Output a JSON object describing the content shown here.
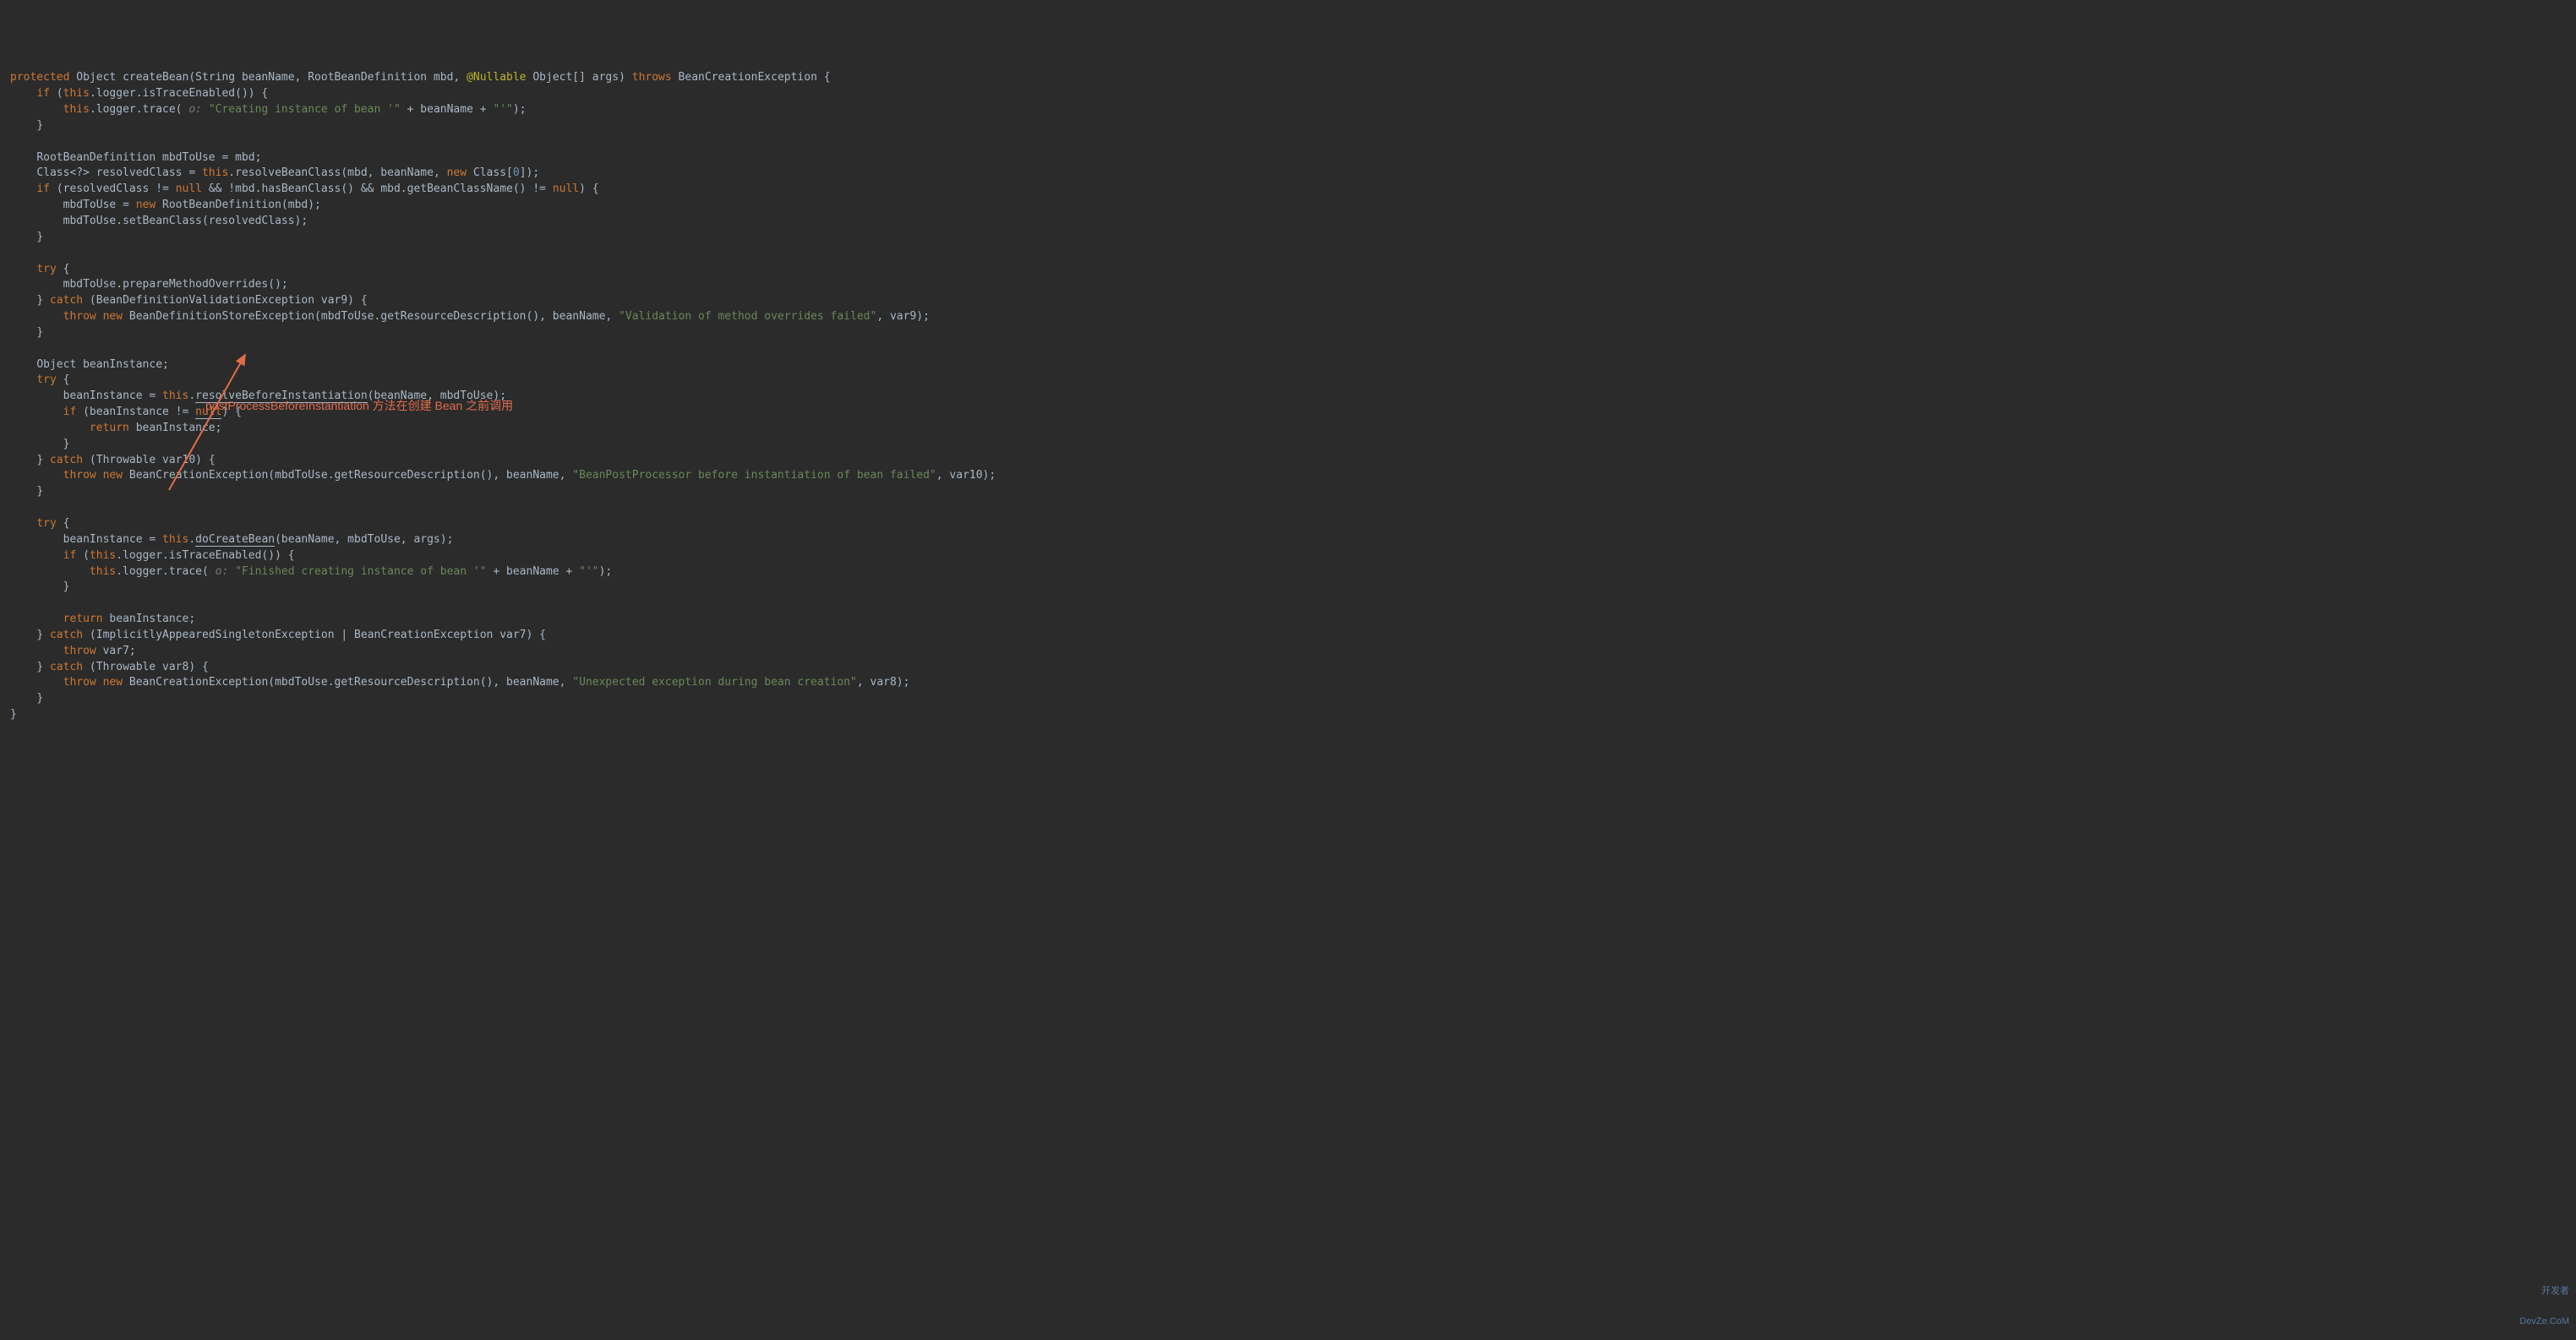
{
  "code": {
    "line1_protected": "protected",
    "line1_rest": " Object createBean(String beanName, RootBeanDefinition mbd, ",
    "line1_ann": "@Nullable",
    "line1_rest2": " Object[] args) ",
    "line1_throws": "throws",
    "line1_rest3": " BeanCreationException {",
    "line2_if": "if",
    "line2_this": "this",
    "line2_rest": ".logger.isTraceEnabled()) {",
    "line3_this": "this",
    "line3_rest1": ".logger.trace(",
    "line3_hint": " o: ",
    "line3_str1": "\"Creating instance of bean '\"",
    "line3_plus": " + beanName + ",
    "line3_str2": "\"'\"",
    "line3_end": ");",
    "line4": "}",
    "line6": "RootBeanDefinition mbdToUse = mbd;",
    "line7_a": "Class<?> resolvedClass = ",
    "line7_this": "this",
    "line7_b": ".resolveBeanClass(mbd, beanName, ",
    "line7_new": "new",
    "line7_c": " Class[",
    "line7_num": "0",
    "line7_d": "]);",
    "line8_if": "if",
    "line8_a": " (resolvedClass != ",
    "line8_null1": "null",
    "line8_b": " && !mbd.hasBeanClass() && mbd.getBeanClassName() != ",
    "line8_null2": "null",
    "line8_c": ") {",
    "line9_a": "mbdToUse = ",
    "line9_new": "new",
    "line9_b": " RootBeanDefinition(mbd);",
    "line10": "mbdToUse.setBeanClass(resolvedClass);",
    "line11": "}",
    "line13_try": "try",
    "line13_b": " {",
    "line14": "mbdToUse.prepareMethodOverrides();",
    "line15_a": "} ",
    "line15_catch": "catch",
    "line15_b": " (BeanDefinitionValidationException var9) {",
    "line16_throw": "throw new",
    "line16_a": " BeanDefinitionStoreException(mbdToUse.getResourceDescription(), beanName, ",
    "line16_str": "\"Validation of method overrides failed\"",
    "line16_b": ", var9);",
    "line17": "}",
    "line19": "Object beanInstance;",
    "line20_try": "try",
    "line20_b": " {",
    "line21_a": "beanInstance = ",
    "line21_this": "this",
    "line21_dot": ".",
    "line21_method": "resolveBeforeInstantiation",
    "line21_b": "(beanName, mbdToUse);",
    "line22_if": "if",
    "line22_a": " (beanInstance != ",
    "line22_null": "null",
    "line22_b": ") {",
    "line23_return": "return",
    "line23_a": " beanInstance;",
    "line24": "}",
    "line25_a": "} ",
    "line25_catch": "catch",
    "line25_b": " (Throwable var10) {",
    "line26_throw": "throw new",
    "line26_a": " BeanCreationException(mbdToUse.getResourceDescription(), beanName, ",
    "line26_str": "\"BeanPostProcessor before instantiation of bean failed\"",
    "line26_b": ", var10);",
    "line27": "}",
    "line29_try": "try",
    "line29_b": " {",
    "line30_a": "beanInstance = ",
    "line30_this": "this",
    "line30_dot": ".",
    "line30_method": "doCreateBean",
    "line30_b": "(beanName, mbdToUse, args);",
    "line31_if": "if",
    "line31_a": " (",
    "line31_this": "this",
    "line31_b": ".logger.isTraceEnabled()) {",
    "line32_this": "this",
    "line32_a": ".logger.trace(",
    "line32_hint": " o: ",
    "line32_str1": "\"Finished creating instance of bean '\"",
    "line32_b": " + beanName + ",
    "line32_str2": "\"'\"",
    "line32_c": ");",
    "line33": "}",
    "line35_return": "return",
    "line35_a": " beanInstance;",
    "line36_a": "} ",
    "line36_catch": "catch",
    "line36_b": " (ImplicitlyAppearedSingletonException | BeanCreationException var7) {",
    "line37_throw": "throw",
    "line37_a": " var7;",
    "line38_a": "} ",
    "line38_catch": "catch",
    "line38_b": " (Throwable var8) {",
    "line39_throw": "throw new",
    "line39_a": " BeanCreationException(mbdToUse.getResourceDescription(), beanName, ",
    "line39_str": "\"Unexpected exception during bean creation\"",
    "line39_b": ", var8);",
    "line40": "}",
    "line41": "}"
  },
  "annotation": {
    "text": "postProcessBeforeInstantiation 方法在创建 Bean 之前调用"
  },
  "watermark": {
    "line1": "开发者",
    "line2": "DevZe.CoM"
  }
}
